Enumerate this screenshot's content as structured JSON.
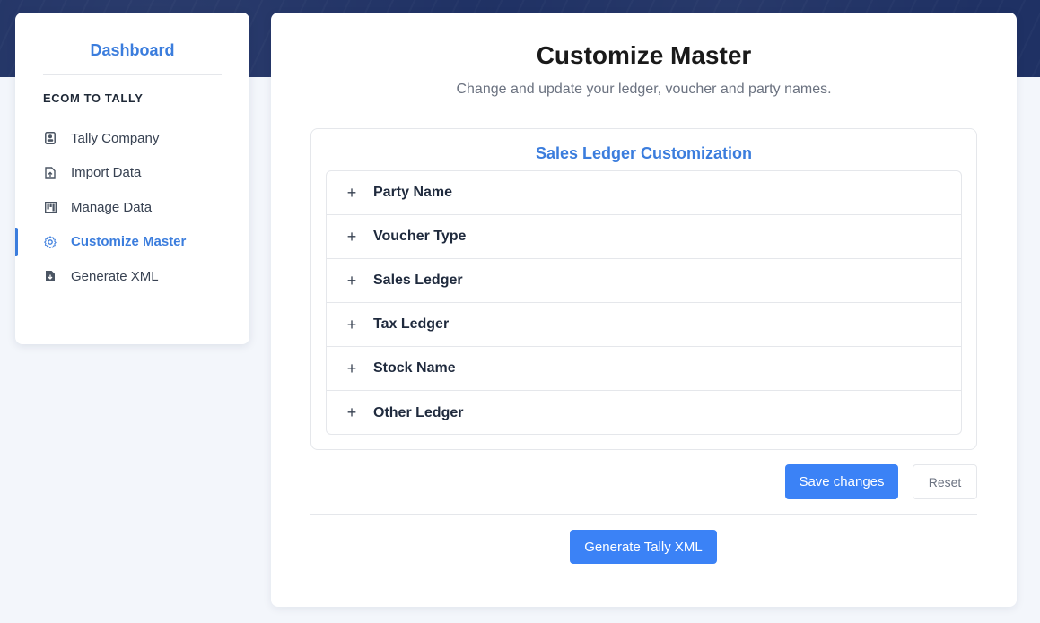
{
  "sidebar": {
    "title": "Dashboard",
    "section": "ECOM TO TALLY",
    "items": [
      {
        "label": "Tally Company",
        "icon": "company-badge-icon",
        "active": false
      },
      {
        "label": "Import Data",
        "icon": "file-upload-icon",
        "active": false
      },
      {
        "label": "Manage Data",
        "icon": "columns-icon",
        "active": false
      },
      {
        "label": "Customize Master",
        "icon": "gear-icon",
        "active": true
      },
      {
        "label": "Generate XML",
        "icon": "file-download-icon",
        "active": false
      }
    ]
  },
  "main": {
    "title": "Customize Master",
    "subtitle": "Change and update your ledger, voucher and party names.",
    "section_title": "Sales Ledger Customization",
    "accordion": [
      {
        "label": "Party Name"
      },
      {
        "label": "Voucher Type"
      },
      {
        "label": "Sales Ledger"
      },
      {
        "label": "Tax Ledger"
      },
      {
        "label": "Stock Name"
      },
      {
        "label": "Other Ledger"
      }
    ],
    "expand_symbol": "+",
    "save_label": "Save changes",
    "reset_label": "Reset",
    "generate_label": "Generate Tally XML"
  },
  "colors": {
    "accent": "#3b7ddd",
    "button": "#3b82f6",
    "header_band": "#1f3164"
  }
}
